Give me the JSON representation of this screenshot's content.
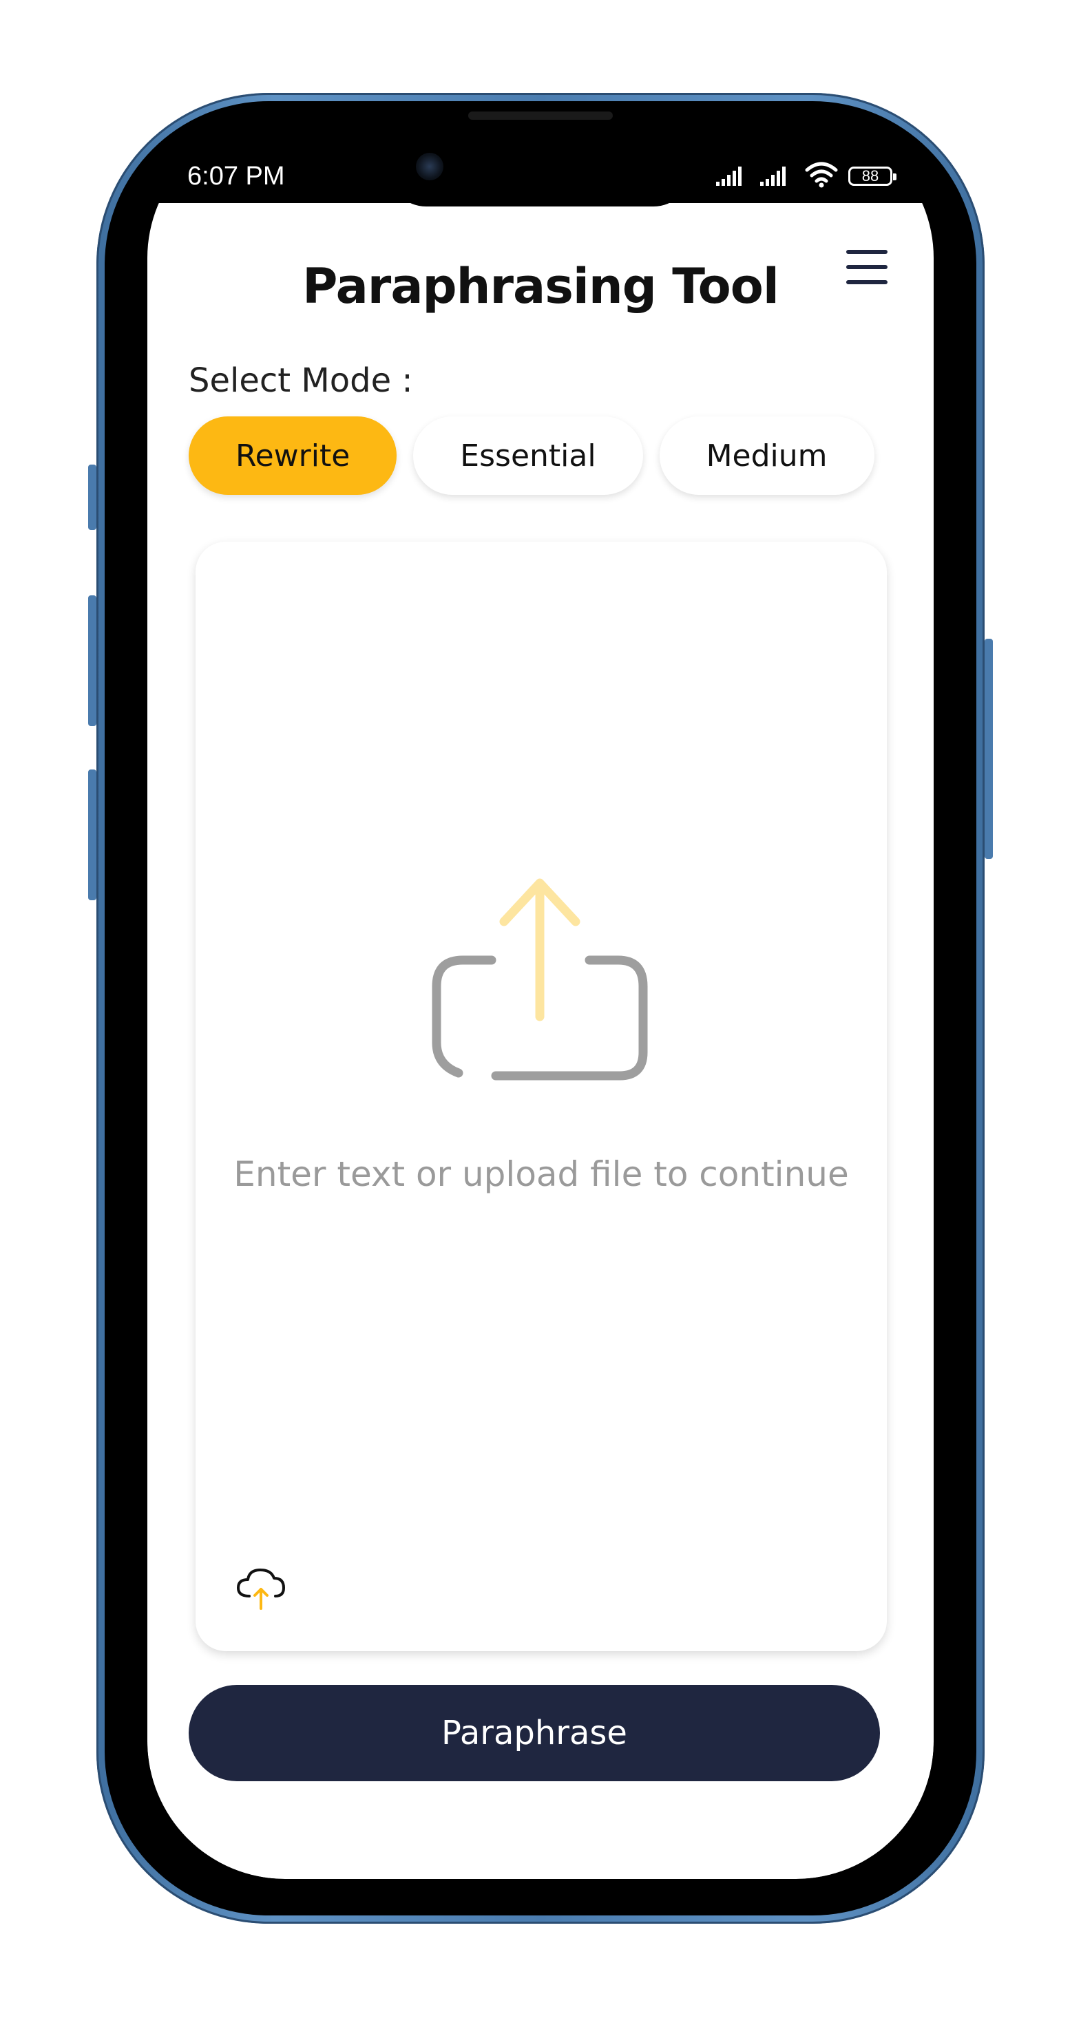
{
  "status_bar": {
    "time": "6:07 PM",
    "battery": "88"
  },
  "header": {
    "title": "Paraphrasing Tool",
    "menu_icon": "hamburger-menu-icon"
  },
  "mode_selector": {
    "label": "Select Mode :",
    "modes": [
      {
        "label": "Rewrite",
        "active": true
      },
      {
        "label": "Essential",
        "active": false
      },
      {
        "label": "Medium",
        "active": false
      }
    ]
  },
  "input_area": {
    "placeholder": "Enter text or upload file to continue",
    "illustration_icon": "upload-share-icon",
    "upload_icon": "cloud-upload-icon"
  },
  "actions": {
    "paraphrase_label": "Paraphrase"
  },
  "colors": {
    "accent": "#FDB813",
    "primary_button": "#1F2640",
    "placeholder_text": "#9a9a9a",
    "frame": "#4B7DB0"
  }
}
